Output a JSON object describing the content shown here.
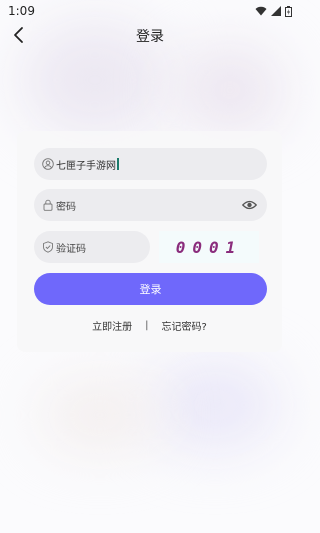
{
  "status_bar": {
    "time": "1:09"
  },
  "header": {
    "title": "登录"
  },
  "form": {
    "username_value": "七匣子手游网",
    "password_placeholder": "密码",
    "captcha_placeholder": "验证码",
    "captcha_code": "0001",
    "login_label": "登录"
  },
  "links": {
    "register_label": "立即注册",
    "separator": "|",
    "forgot_label": "忘记密码?"
  },
  "colors": {
    "accent": "#6f68fb",
    "captcha_text": "#8a2c7c"
  }
}
